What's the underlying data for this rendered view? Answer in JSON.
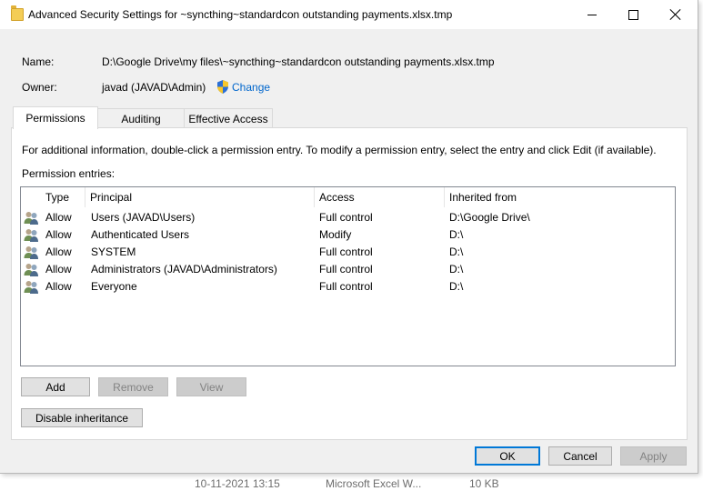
{
  "window": {
    "title": "Advanced Security Settings for ~syncthing~standardcon outstanding payments.xlsx.tmp"
  },
  "info": {
    "name_label": "Name:",
    "name_value": "D:\\Google Drive\\my files\\~syncthing~standardcon outstanding payments.xlsx.tmp",
    "owner_label": "Owner:",
    "owner_value": "javad (JAVAD\\Admin)",
    "change_link": "Change"
  },
  "tabs": [
    {
      "label": "Permissions",
      "active": true
    },
    {
      "label": "Auditing",
      "active": false
    },
    {
      "label": "Effective Access",
      "active": false
    }
  ],
  "permissions": {
    "instruction": "For additional information, double-click a permission entry. To modify a permission entry, select the entry and click Edit (if available).",
    "entries_label": "Permission entries:",
    "columns": [
      "Type",
      "Principal",
      "Access",
      "Inherited from"
    ],
    "rows": [
      {
        "type": "Allow",
        "principal": "Users (JAVAD\\Users)",
        "access": "Full control",
        "inherited": "D:\\Google Drive\\"
      },
      {
        "type": "Allow",
        "principal": "Authenticated Users",
        "access": "Modify",
        "inherited": "D:\\"
      },
      {
        "type": "Allow",
        "principal": "SYSTEM",
        "access": "Full control",
        "inherited": "D:\\"
      },
      {
        "type": "Allow",
        "principal": "Administrators (JAVAD\\Administrators)",
        "access": "Full control",
        "inherited": "D:\\"
      },
      {
        "type": "Allow",
        "principal": "Everyone",
        "access": "Full control",
        "inherited": "D:\\"
      }
    ],
    "buttons": {
      "add": "Add",
      "remove": "Remove",
      "view": "View"
    },
    "disable_inheritance": "Disable inheritance"
  },
  "footer": {
    "ok": "OK",
    "cancel": "Cancel",
    "apply": "Apply"
  },
  "background": {
    "date": "10-11-2021 13:15",
    "type": "Microsoft Excel W...",
    "size": "10 KB"
  },
  "colors": {
    "accent": "#0078d7",
    "link": "#0066cc",
    "dialog_bg": "#f0f0f0"
  }
}
